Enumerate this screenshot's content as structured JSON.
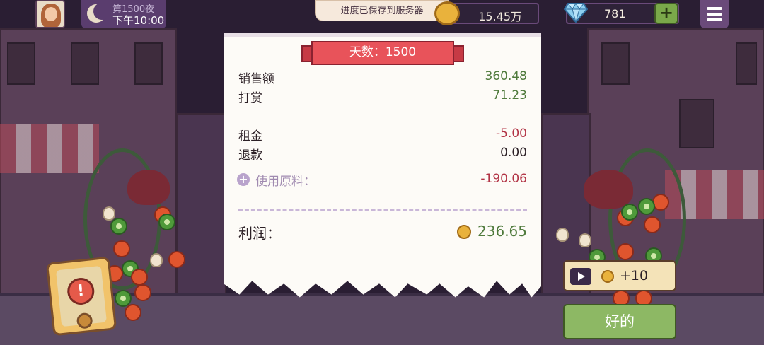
{
  "hud": {
    "night_label": "第1500夜",
    "time_label": "下午10:00",
    "save_toast": "进度已保存到服务器",
    "coins": "15.45万",
    "gems": "781",
    "plus_label": "+",
    "icons": [
      "avatar",
      "moon-icon",
      "coin-icon",
      "diamond-icon",
      "plus-icon",
      "menu-icon"
    ]
  },
  "receipt": {
    "day_banner": "天数：1500",
    "rows": [
      {
        "label": "销售额",
        "value": "360.48",
        "color": "#4f7a3c"
      },
      {
        "label": "打赏",
        "value": "71.23",
        "color": "#4f7a3c"
      },
      {
        "label": "租金",
        "value": "-5.00",
        "color": "#b23446"
      },
      {
        "label": "退款",
        "value": "0.00",
        "color": "#2c2026"
      }
    ],
    "ingredients_label": "使用原料：",
    "ingredients_value": "-190.06",
    "profit_label": "利润：",
    "profit_value": "236.65"
  },
  "actions": {
    "ad_reward": "+10",
    "ok_label": "好的",
    "alert_mark": "!"
  },
  "colors": {
    "positive": "#4f7a3c",
    "negative": "#b23446",
    "banner": "#e8535a",
    "ok_button": "#8db864"
  }
}
